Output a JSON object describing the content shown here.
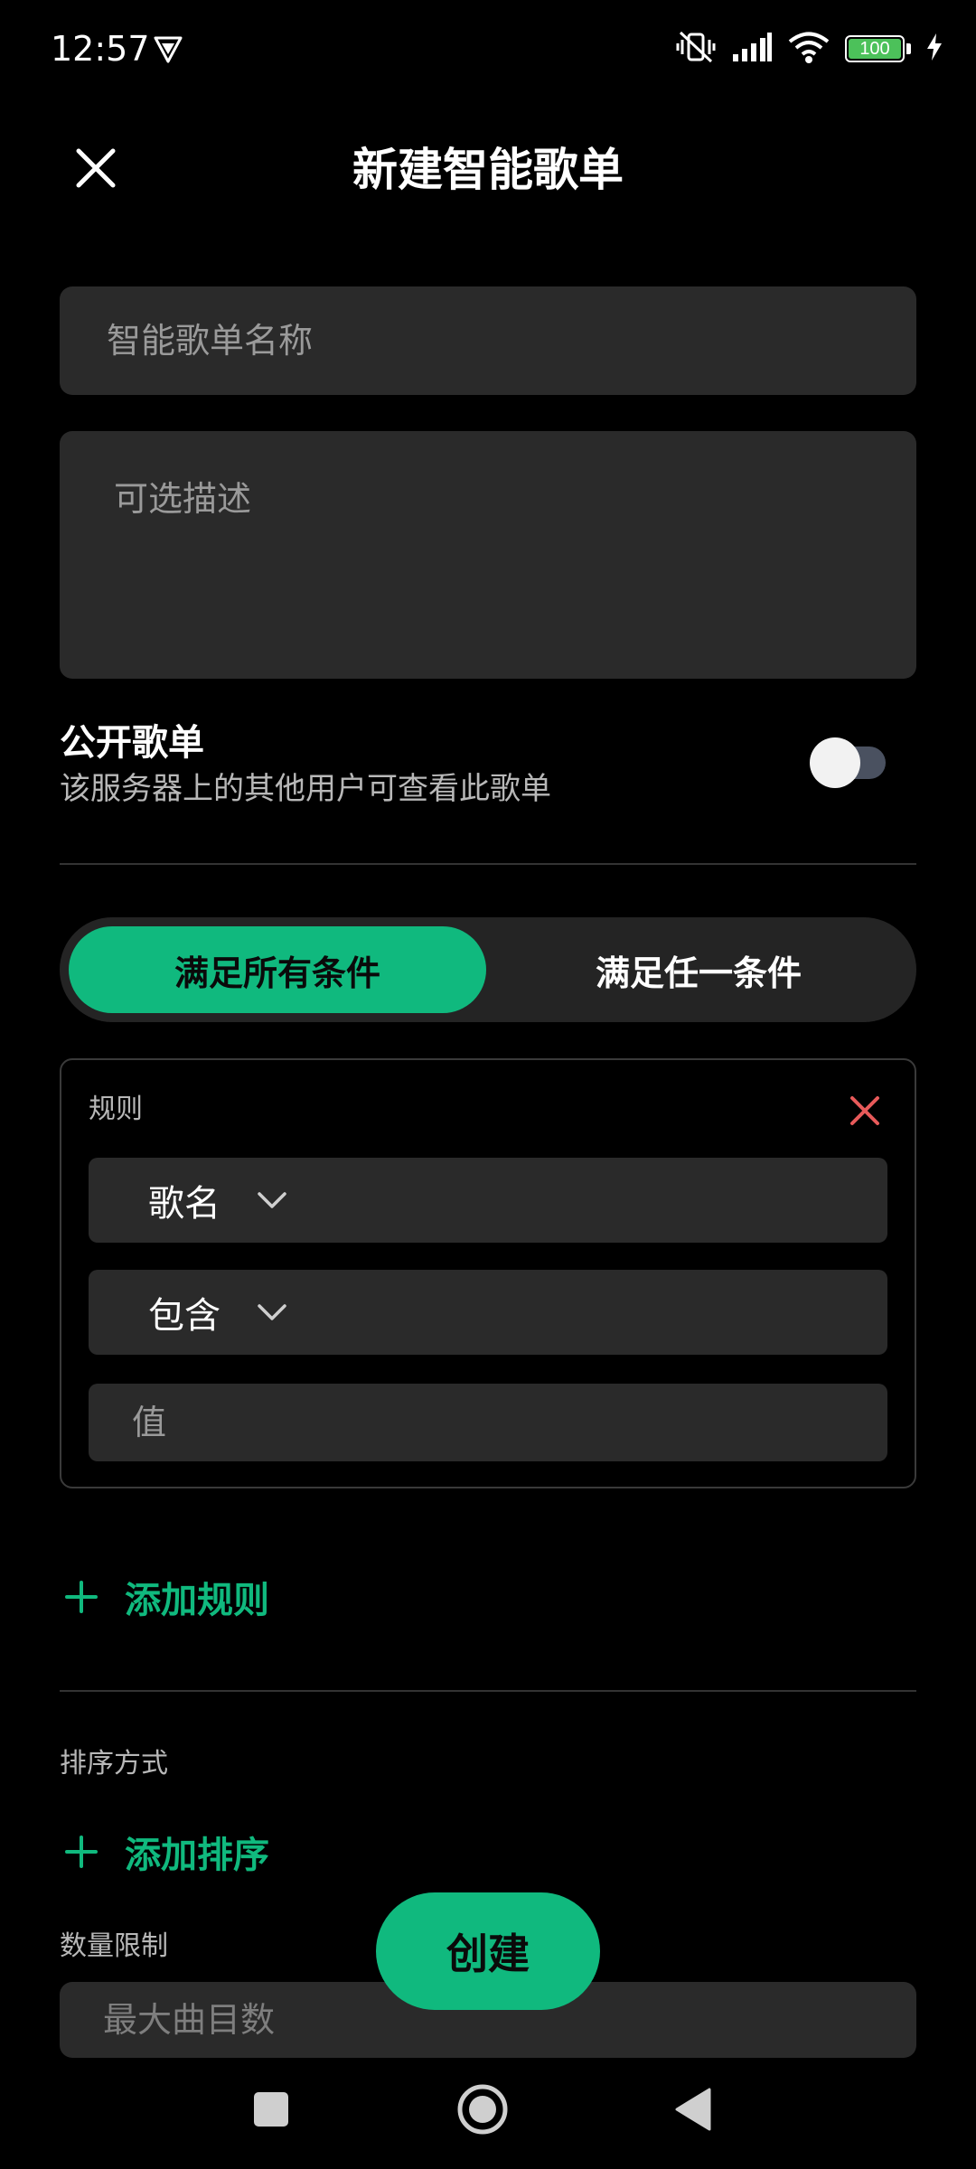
{
  "status_bar": {
    "time": "12:57",
    "battery_level": "100",
    "battery_fraction": 1.0,
    "icons": [
      "app-notification-icon",
      "vibrate-mute-icon",
      "signal-icon",
      "wifi-icon",
      "battery-icon",
      "charging-icon"
    ]
  },
  "header": {
    "title": "新建智能歌单",
    "close_icon": "close-icon"
  },
  "form": {
    "name_placeholder": "智能歌单名称",
    "name_value": "",
    "description_placeholder": "可选描述",
    "description_value": ""
  },
  "public_setting": {
    "title": "公开歌单",
    "subtitle": "该服务器上的其他用户可查看此歌单",
    "enabled": false
  },
  "match_mode": {
    "options": [
      "满足所有条件",
      "满足任一条件"
    ],
    "selected": "满足所有条件"
  },
  "rules": {
    "label": "规则",
    "items": [
      {
        "field": "歌名",
        "operator": "包含",
        "value_placeholder": "值",
        "value": ""
      }
    ],
    "add_label": "添加规则"
  },
  "sort": {
    "label": "排序方式",
    "add_label": "添加排序"
  },
  "limit": {
    "label": "数量限制",
    "placeholder": "最大曲目数",
    "value": ""
  },
  "create_button": "创建",
  "nav_bar": {
    "icons": [
      "recents-icon",
      "home-icon",
      "back-icon"
    ]
  },
  "colors": {
    "accent": "#10b97e",
    "delete": "#e85a5a",
    "background": "#000000",
    "surface": "#2a2a2a"
  }
}
